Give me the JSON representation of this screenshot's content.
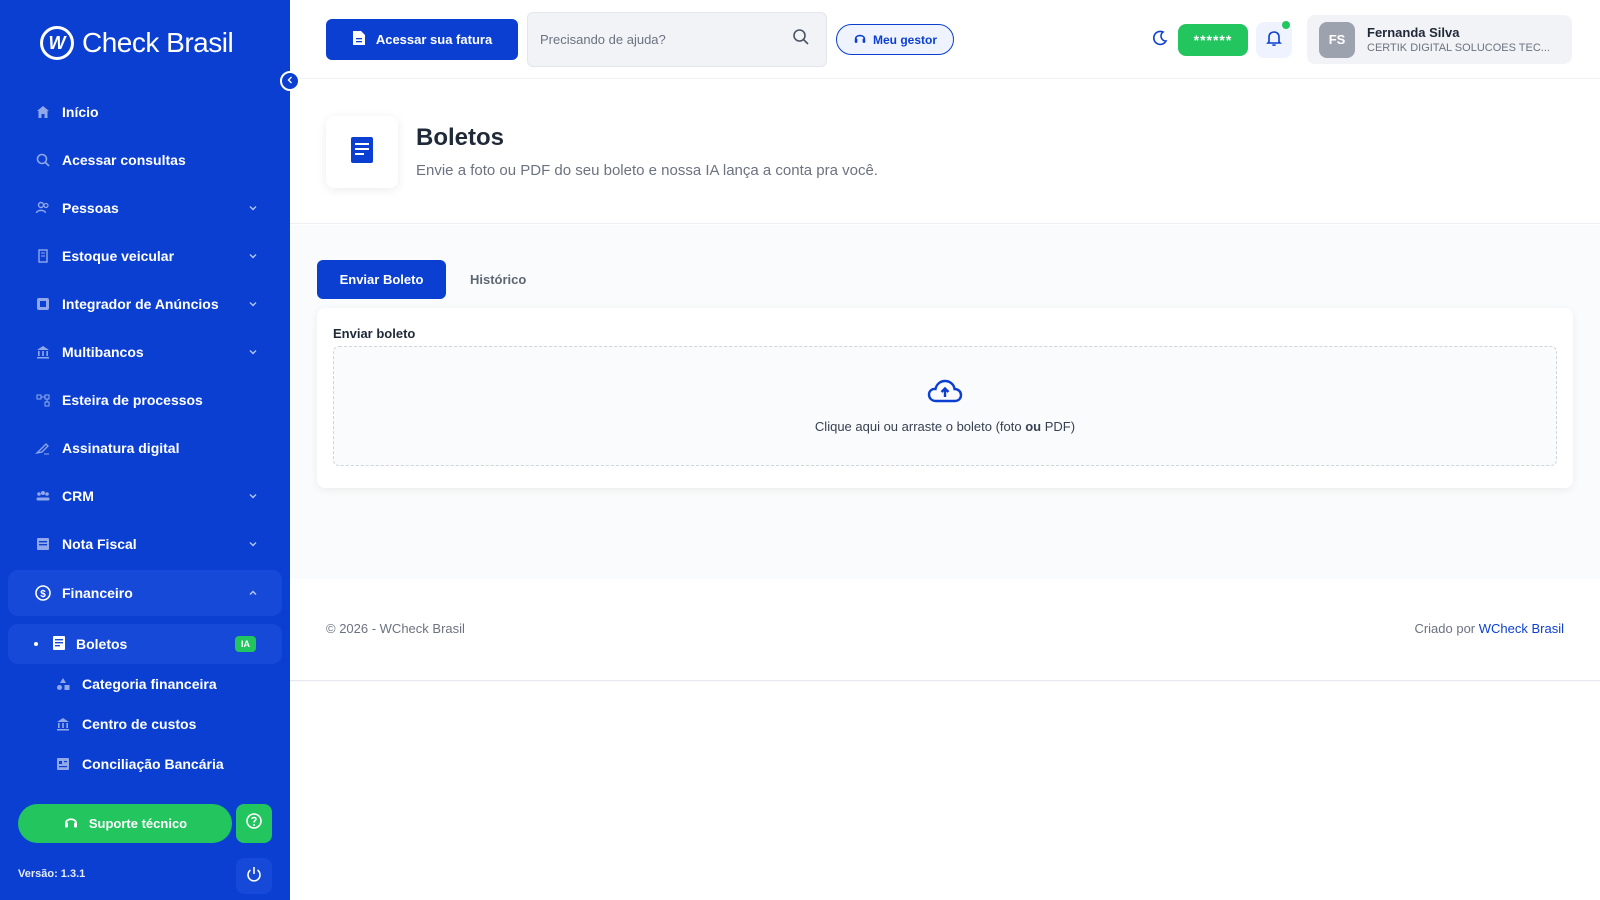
{
  "app": {
    "brand": "Check Brasil",
    "logo_letter": "W"
  },
  "sidebar": {
    "items": [
      {
        "label": "Início",
        "icon": "home-icon"
      },
      {
        "label": "Acessar consultas",
        "icon": "search-icon"
      },
      {
        "label": "Pessoas",
        "icon": "people-icon",
        "expandable": true
      },
      {
        "label": "Estoque veicular",
        "icon": "building-icon",
        "expandable": true
      },
      {
        "label": "Integrador de Anúncios",
        "icon": "ad-icon",
        "expandable": true
      },
      {
        "label": "Multibancos",
        "icon": "bank-icon",
        "expandable": true
      },
      {
        "label": "Esteira de processos",
        "icon": "process-icon"
      },
      {
        "label": "Assinatura digital",
        "icon": "signature-icon"
      },
      {
        "label": "CRM",
        "icon": "crm-icon",
        "expandable": true
      },
      {
        "label": "Nota Fiscal",
        "icon": "invoice-icon",
        "expandable": true
      },
      {
        "label": "Financeiro",
        "icon": "finance-icon",
        "expanded": true
      }
    ],
    "sub_items": [
      {
        "label": "Boletos",
        "badge": "IA",
        "active": true
      },
      {
        "label": "Categoria financeira",
        "icon": "category-icon"
      },
      {
        "label": "Centro de custos",
        "icon": "bank-icon"
      },
      {
        "label": "Conciliação Bancária",
        "icon": "reconcile-icon"
      }
    ],
    "support_label": "Suporte técnico",
    "version": "Versão: 1.3.1"
  },
  "topbar": {
    "fatura_label": "Acessar sua fatura",
    "search_placeholder": "Precisando de ajuda?",
    "gestor_label": "Meu gestor",
    "password_mask": "******",
    "user": {
      "initials": "FS",
      "name": "Fernanda Silva",
      "company": "CERTIK DIGITAL SOLUCOES TEC..."
    }
  },
  "page": {
    "title": "Boletos",
    "subtitle": "Envie a foto ou PDF do seu boleto e nossa IA lança a conta pra você."
  },
  "tabs": {
    "active": "Enviar Boleto",
    "other": "Histórico"
  },
  "upload": {
    "label": "Enviar boleto",
    "text_before": "Clique aqui ou arraste o boleto (foto ",
    "text_bold": "ou",
    "text_after": " PDF)"
  },
  "footer": {
    "copyright": "© 2026 - WCheck Brasil",
    "created_prefix": "Criado por ",
    "created_link": "WCheck Brasil"
  },
  "colors": {
    "primary": "#0b3fd1",
    "success": "#22c55e"
  }
}
